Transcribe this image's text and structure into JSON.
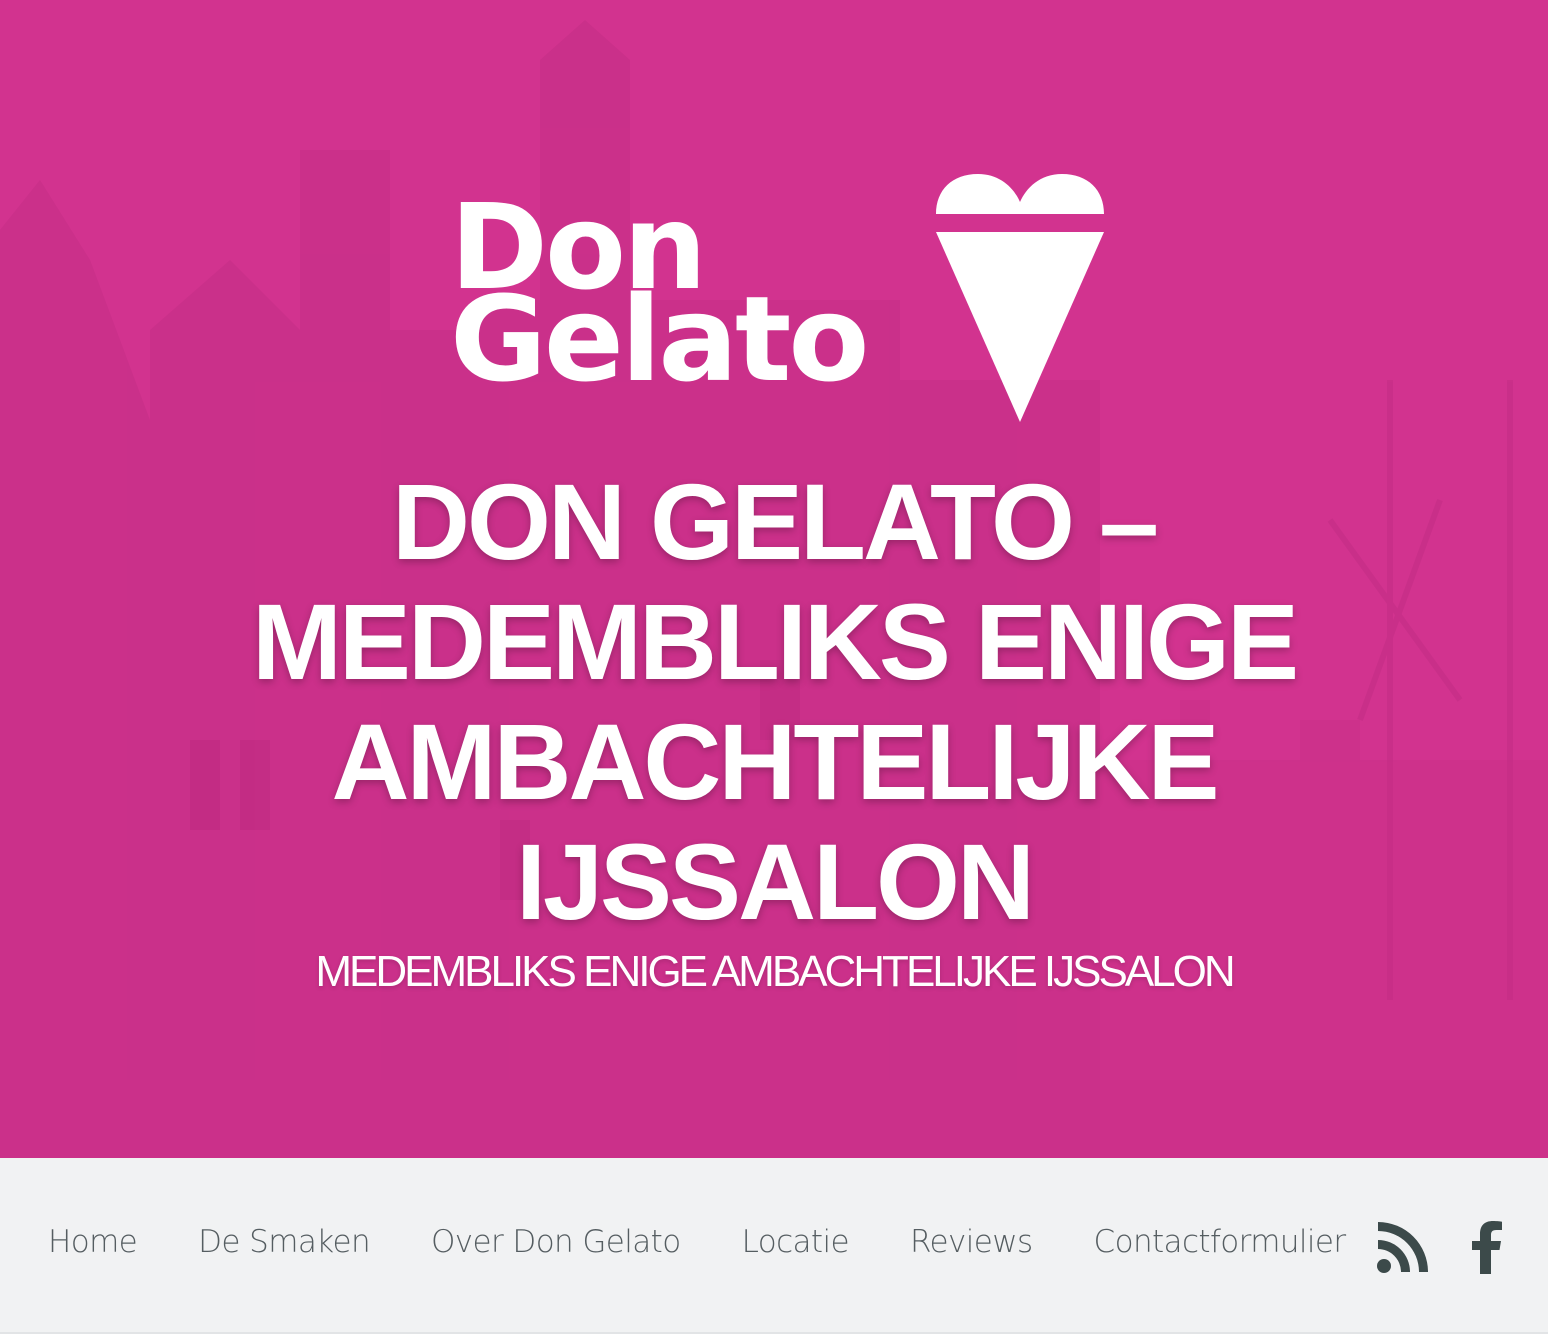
{
  "logo": {
    "line1": "Don",
    "line2": "Gelato"
  },
  "header": {
    "title": "DON GELATO – MEDEMBLIKS ENIGE AMBACHTELIJKE IJSSALON",
    "tagline": "MEDEMBLIKS ENIGE AMBACHTELIJKE IJSSALON"
  },
  "nav": {
    "items": [
      {
        "label": "Home"
      },
      {
        "label": "De Smaken"
      },
      {
        "label": "Over Don Gelato"
      },
      {
        "label": "Locatie"
      },
      {
        "label": "Reviews"
      },
      {
        "label": "Contactformulier"
      }
    ]
  },
  "social": {
    "icons": [
      "rss-icon",
      "facebook-icon"
    ]
  },
  "colors": {
    "brand_pink": "#d2338f",
    "nav_bg": "#f1f2f3",
    "nav_text": "#555d61",
    "icon": "#3c4a4a"
  }
}
